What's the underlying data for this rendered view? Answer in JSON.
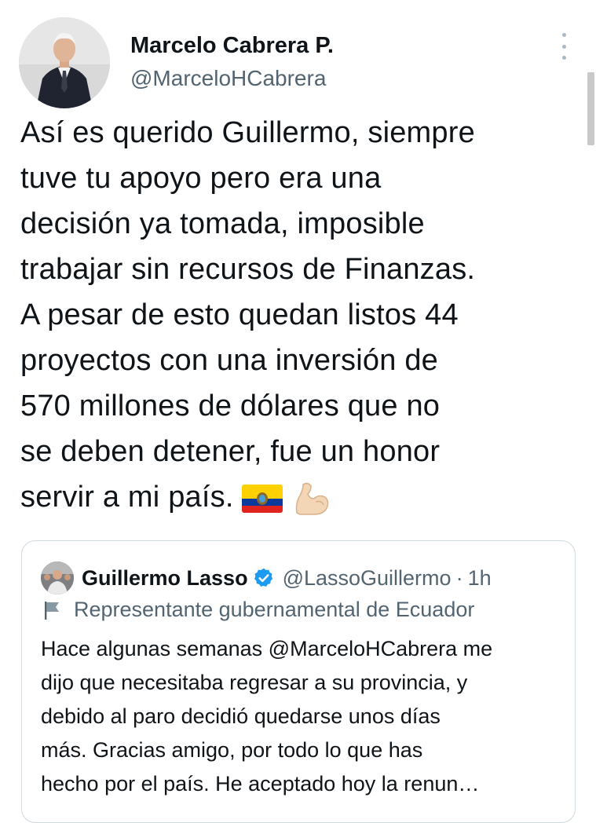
{
  "author": {
    "display_name": "Marcelo Cabrera P.",
    "handle": "@MarceloHCabrera",
    "avatar_icon": "person-in-suit-photo"
  },
  "more_icon": "more-vertical-icon",
  "tweet": {
    "text": "Así es querido Guillermo, siempre\ntuve tu apoyo pero era una\ndecisión ya tomada, imposible\ntrabajar sin recursos de Finanzas.\nA pesar de esto quedan listos 44\nproyectos con una inversión de\n570 millones de dólares que no\nse deben detener, fue un honor\nservir a mi país.",
    "emojis": [
      "ecuador-flag-emoji",
      "flexed-biceps-emoji"
    ]
  },
  "quoted_tweet": {
    "display_name": "Guillermo Lasso",
    "verified_icon": "verified-badge-icon",
    "handle": "@LassoGuillermo",
    "separator": "·",
    "time": "1h",
    "affiliation_icon": "flag-icon",
    "affiliation": "Representante gubernamental de Ecuador",
    "text": "Hace algunas semanas @MarceloHCabrera me\ndijo que necesitaba regresar a su provincia, y\ndebido al paro decidió quedarse unos días\nmás. Gracias amigo, por todo lo que has\nhecho por el país. He aceptado hoy la renun…"
  },
  "colors": {
    "text_primary": "#0f1419",
    "text_secondary": "#536471",
    "verified_blue": "#1d9bf0",
    "border": "#cfd9de"
  }
}
